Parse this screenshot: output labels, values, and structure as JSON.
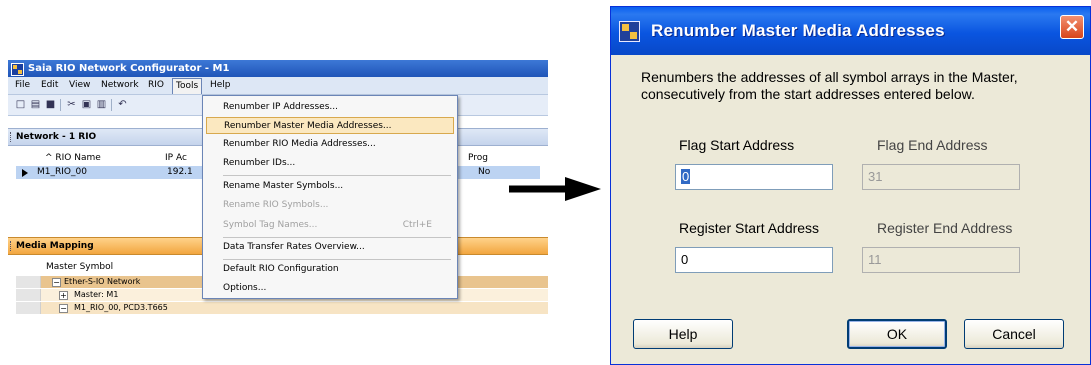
{
  "app": {
    "title": "Saia RIO Network Configurator - M1",
    "menu": [
      "File",
      "Edit",
      "View",
      "Network",
      "RIO",
      "Tools",
      "Help"
    ],
    "network_panel": {
      "header": "Network - 1 RIO",
      "columns": [
        "^ RIO Name",
        "IP Ac",
        "Prog"
      ],
      "row": {
        "name": "M1_RIO_00",
        "ip": "192.1",
        "prog": "No"
      }
    },
    "media_panel": {
      "header": "Media Mapping",
      "column": "Master Symbol",
      "tree": [
        {
          "toggle": "−",
          "label": "Ether-S-IO Network"
        },
        {
          "toggle": "+",
          "label": "Master: M1"
        },
        {
          "toggle": "−",
          "label": "M1_RIO_00, PCD3.T665"
        }
      ]
    },
    "tools_menu": {
      "items": [
        {
          "label": "Renumber IP Addresses...",
          "state": "normal"
        },
        {
          "label": "Renumber Master Media Addresses...",
          "state": "highlighted"
        },
        {
          "label": "Renumber RIO Media Addresses...",
          "state": "normal"
        },
        {
          "label": "Renumber IDs...",
          "state": "normal"
        },
        {
          "label": "Rename Master Symbols...",
          "state": "normal"
        },
        {
          "label": "Rename RIO Symbols...",
          "state": "disabled"
        },
        {
          "label": "Symbol Tag Names...",
          "state": "disabled",
          "shortcut": "Ctrl+E"
        },
        {
          "label": "Data Transfer Rates Overview...",
          "state": "normal"
        },
        {
          "label": "Default RIO Configuration",
          "state": "normal"
        },
        {
          "label": "Options...",
          "state": "normal"
        }
      ]
    }
  },
  "dialog": {
    "title": "Renumber Master Media Addresses",
    "close_glyph": "✕",
    "description": [
      "Renumbers the addresses of all symbol arrays in the Master,",
      "consecutively from the start addresses entered below."
    ],
    "flag_start": {
      "label": "Flag Start Address",
      "value": "0"
    },
    "flag_end": {
      "label": "Flag End Address",
      "value": "31"
    },
    "register_start": {
      "label": "Register Start Address",
      "value": "0"
    },
    "register_end": {
      "label": "Register End Address",
      "value": "11"
    },
    "buttons": {
      "help": "Help",
      "ok": "OK",
      "cancel": "Cancel"
    }
  },
  "colors": {
    "xp_title_blue": "#0a55e0",
    "dialog_bg": "#ece9d8",
    "menu_highlight": "#fbe8c0",
    "media_header": "#f2a640",
    "selected_row": "#bcd3f2"
  },
  "icons": [
    "app-icon",
    "new-icon",
    "open-icon",
    "save-icon",
    "cut-icon",
    "copy-icon",
    "paste-icon",
    "undo-icon",
    "close-icon",
    "arrow-right-icon"
  ]
}
